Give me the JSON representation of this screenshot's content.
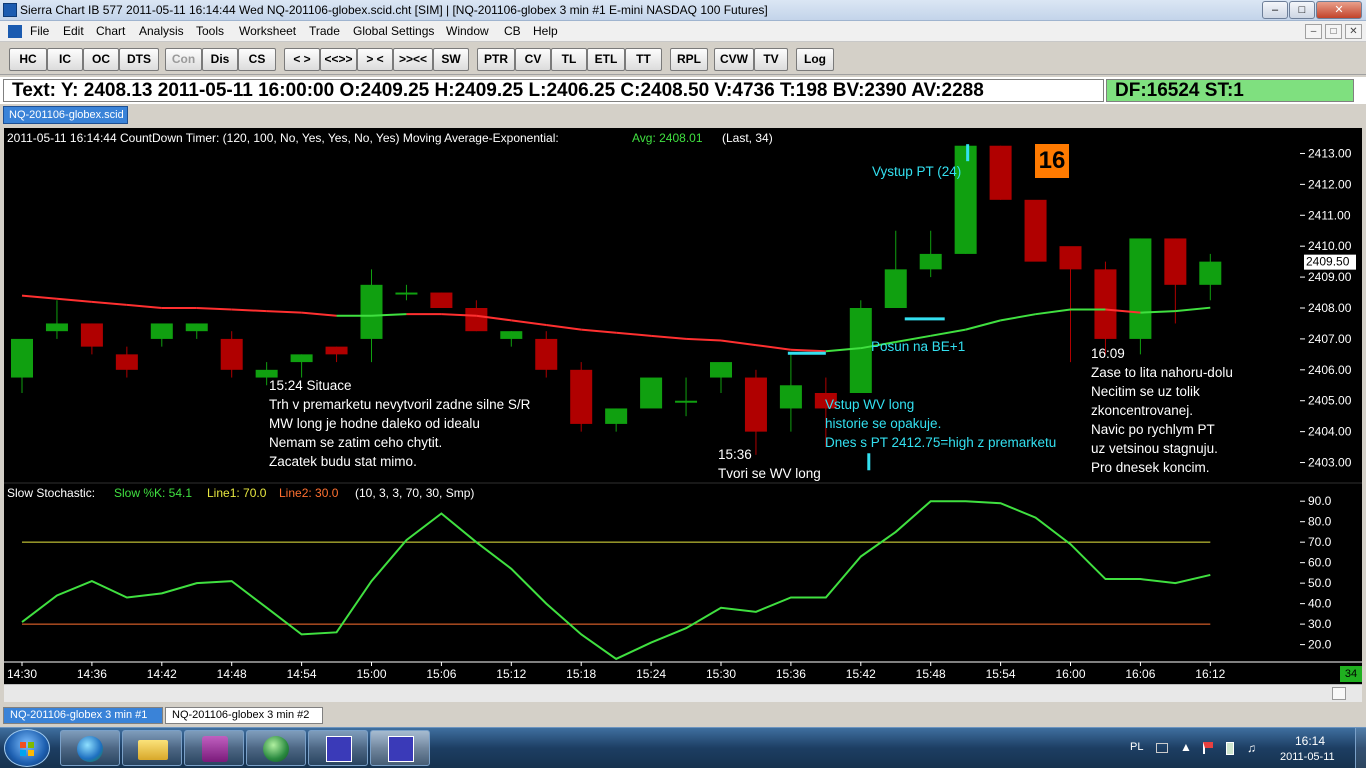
{
  "window": {
    "title": "Sierra Chart IB 577  2011-05-11  16:14:44  Wed    NQ-201106-globex.scid.cht [SIM]  |  [NQ-201106-globex  3 min   #1  E-mini NASDAQ 100 Futures]",
    "minimize": "–",
    "maximize": "□",
    "close": "✕"
  },
  "menu": [
    "File",
    "Edit",
    "Chart",
    "Analysis",
    "Tools",
    "Worksheet",
    "Trade",
    "Global Settings",
    "Window",
    "CB",
    "Help"
  ],
  "mdi": [
    "–",
    "□",
    "✕"
  ],
  "toolbar": [
    "HC",
    "IC",
    "OC",
    "DTS",
    "Con",
    "Dis",
    "CS",
    "< >",
    "<<>>",
    "> <",
    ">><<",
    "SW",
    "PTR",
    "CV",
    "TL",
    "ETL",
    "TT",
    "RPL",
    "CVW",
    "TV",
    "Log"
  ],
  "info": {
    "text": "Text: Y: 2408.13  2011-05-11  16:00:00  O:2409.25  H:2409.25  L:2406.25  C:2408.50  V:4736  T:198  BV:2390  AV:2288",
    "df": "DF:16524  ST:1"
  },
  "chart_tab": "NQ-201106-globex.scid",
  "chart_header": {
    "left": "2011-05-11 16:14:44 CountDown Timer:   (120, 100, No, Yes, Yes, No, Yes)   Moving Average-Exponential:",
    "avg": "Avg: 2408.01",
    "last": "(Last, 34)"
  },
  "countdown": "16",
  "stoch_header": {
    "label": "Slow Stochastic:",
    "k": "Slow %K: 54.1",
    "l1": "Line1: 70.0",
    "l2": "Line2: 30.0",
    "params": "(10, 3, 3, 70, 30, Smp)"
  },
  "scroll_badge": "34",
  "sheet_tabs": [
    "NQ-201106-globex  3 min   #1",
    "NQ-201106-globex  3 min   #2"
  ],
  "annotations": [
    {
      "text": "15:24 Situace\nTrh v premarketu nevytvoril zadne silne S/R\nMW long je hodne daleko od idealu\nNemam se zatim ceho chytit.\nZacatek budu stat mimo.",
      "color": "#ffffff"
    },
    {
      "text": "15:36\nTvori se WV long",
      "color": "#ffffff"
    },
    {
      "text": "Vstup WV long\nhistorie se opakuje.\nDnes s PT 2412.75=high z premarketu",
      "color": "#33e0f0"
    },
    {
      "text": "Posun na BE+1",
      "color": "#33e0f0"
    },
    {
      "text": "Vystup PT (24)",
      "color": "#33e0f0"
    },
    {
      "text": "16:09\nZase to lita nahoru-dolu\nNecitim se uz tolik\nzkoncentrovanej.\nNavic po rychlym PT\nuz vetsinou stagnuju.\nPro dnesek koncim.",
      "color": "#ffffff"
    }
  ],
  "taskbar": {
    "lang": "PL",
    "time": "16:14",
    "date": "2011-05-11"
  },
  "chart_data": [
    {
      "type": "candlestick",
      "title": "",
      "x": [
        "14:30",
        "14:33",
        "14:36",
        "14:39",
        "14:42",
        "14:45",
        "14:48",
        "14:51",
        "14:54",
        "14:57",
        "15:00",
        "15:03",
        "15:06",
        "15:09",
        "15:12",
        "15:15",
        "15:18",
        "15:21",
        "15:24",
        "15:27",
        "15:30",
        "15:33",
        "15:36",
        "15:39",
        "15:42",
        "15:45",
        "15:48",
        "15:51",
        "15:54",
        "15:57",
        "16:00",
        "16:03",
        "16:06",
        "16:09",
        "16:12"
      ],
      "open": [
        2405.75,
        2407.25,
        2407.5,
        2406.5,
        2407.0,
        2407.25,
        2407.0,
        2405.75,
        2406.25,
        2406.75,
        2407.0,
        2408.5,
        2408.5,
        2408.0,
        2407.0,
        2407.0,
        2406.0,
        2404.25,
        2404.75,
        2405.0,
        2405.75,
        2405.75,
        2404.75,
        2405.25,
        2405.25,
        2408.0,
        2409.25,
        2409.75,
        2413.25,
        2411.5,
        2410.0,
        2409.25,
        2407.0,
        2410.25,
        2408.75
      ],
      "high": [
        2406.25,
        2408.25,
        2407.5,
        2406.75,
        2407.25,
        2407.5,
        2407.25,
        2406.25,
        2406.5,
        2406.75,
        2409.25,
        2408.75,
        2408.5,
        2408.25,
        2407.25,
        2407.25,
        2406.25,
        2404.75,
        2404.75,
        2405.75,
        2406.25,
        2406.0,
        2406.5,
        2405.75,
        2408.25,
        2410.5,
        2410.5,
        2413.25,
        2413.25,
        2411.25,
        2409.75,
        2409.5,
        2410.25,
        2410.25,
        2409.75
      ],
      "low": [
        2405.25,
        2407.0,
        2406.5,
        2405.75,
        2406.75,
        2407.0,
        2405.75,
        2405.5,
        2405.75,
        2406.25,
        2406.25,
        2408.25,
        2408.0,
        2407.25,
        2406.75,
        2405.75,
        2404.0,
        2404.0,
        2404.75,
        2404.5,
        2405.25,
        2403.25,
        2404.0,
        2403.5,
        2405.25,
        2408.0,
        2409.0,
        2409.75,
        2411.5,
        2410.0,
        2406.25,
        2406.5,
        2406.5,
        2407.5,
        2408.25
      ],
      "close": [
        2407.0,
        2407.5,
        2406.75,
        2406.0,
        2407.5,
        2407.5,
        2406.0,
        2406.0,
        2406.5,
        2406.5,
        2408.75,
        2408.5,
        2408.0,
        2407.25,
        2407.25,
        2406.0,
        2404.25,
        2404.75,
        2405.75,
        2405.0,
        2406.25,
        2404.0,
        2405.5,
        2404.75,
        2408.0,
        2409.25,
        2409.75,
        2413.25,
        2411.5,
        2409.5,
        2409.25,
        2407.0,
        2410.25,
        2408.75,
        2409.5
      ],
      "ema": [
        2408.4,
        2408.3,
        2408.2,
        2408.1,
        2408.0,
        2408.0,
        2407.95,
        2407.9,
        2407.85,
        2407.75,
        2407.75,
        2407.8,
        2407.8,
        2407.75,
        2407.6,
        2407.45,
        2407.3,
        2407.2,
        2407.1,
        2407.0,
        2406.95,
        2406.8,
        2406.65,
        2406.6,
        2406.7,
        2406.9,
        2407.1,
        2407.3,
        2407.6,
        2407.8,
        2407.95,
        2407.95,
        2407.85,
        2407.9,
        2408.01
      ],
      "ema_trend": [
        "down",
        "down",
        "down",
        "down",
        "down",
        "down",
        "down",
        "down",
        "down",
        "down",
        "up",
        "up",
        "down",
        "down",
        "down",
        "down",
        "down",
        "down",
        "down",
        "down",
        "down",
        "down",
        "down",
        "down",
        "up",
        "up",
        "up",
        "up",
        "up",
        "up",
        "up",
        "up",
        "down",
        "up",
        "up"
      ],
      "ylim": [
        2402.5,
        2413.5
      ],
      "yticks": [
        2403,
        2404,
        2405,
        2406,
        2407,
        2408,
        2409,
        2410,
        2411,
        2412,
        2413
      ],
      "last_price": "2409.50",
      "colors": {
        "up": "#10a010",
        "down": "#b00000",
        "ema_down": "#ff3030",
        "ema_up": "#40e040"
      }
    },
    {
      "type": "line",
      "title": "",
      "x": [
        "14:30",
        "14:33",
        "14:36",
        "14:39",
        "14:42",
        "14:45",
        "14:48",
        "14:51",
        "14:54",
        "14:57",
        "15:00",
        "15:03",
        "15:06",
        "15:09",
        "15:12",
        "15:15",
        "15:18",
        "15:21",
        "15:24",
        "15:27",
        "15:30",
        "15:33",
        "15:36",
        "15:39",
        "15:42",
        "15:45",
        "15:48",
        "15:51",
        "15:54",
        "15:57",
        "16:00",
        "16:03",
        "16:06",
        "16:09",
        "16:12"
      ],
      "series": [
        {
          "name": "Slow %K",
          "values": [
            31,
            44,
            51,
            43,
            45,
            50,
            51,
            38,
            25,
            26,
            51,
            71,
            84,
            70,
            57,
            40,
            25,
            13,
            21,
            28,
            38,
            36,
            43,
            43,
            63,
            75,
            90,
            90,
            89,
            82,
            69,
            52,
            52,
            50,
            54
          ]
        }
      ],
      "lines": {
        "line1": 70,
        "line2": 30
      },
      "ylim": [
        12,
        94
      ],
      "yticks": [
        20,
        30,
        40,
        50,
        60,
        70,
        80,
        90
      ],
      "colors": {
        "k": "#40e040",
        "line1": "#e8e840",
        "line2": "#ff7030"
      }
    }
  ]
}
